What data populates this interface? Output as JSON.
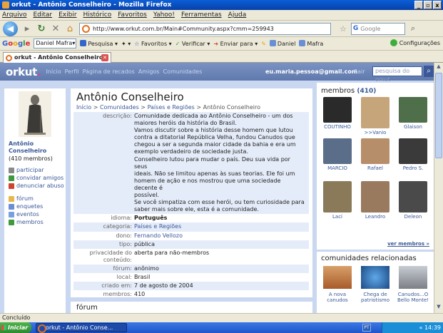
{
  "window": {
    "title": "orkut - Antônio Conselheiro - Mozilla Firefox",
    "controls": [
      "_",
      "▫",
      "x"
    ]
  },
  "menu": [
    "Arquivo",
    "Editar",
    "Exibir",
    "Histórico",
    "Favoritos",
    "Yahoo!",
    "Ferramentas",
    "Ajuda"
  ],
  "nav": {
    "url": "http://www.orkut.com.br/Main#Community.aspx?cmm=259943",
    "search_placeholder": "Google"
  },
  "gtoolbar": {
    "logo": [
      "G",
      "o",
      "o",
      "g",
      "l",
      "e"
    ],
    "user": "Daniel Mafra",
    "items": [
      "Pesquisa",
      "Favoritos",
      "Verificar",
      "Enviar para",
      "Daniel",
      "Mafra"
    ],
    "config": "Configurações"
  },
  "tab": {
    "label": "orkut - Antônio Conselheiro"
  },
  "orkut": {
    "logo": "orkut",
    "nav": [
      "Início",
      "Perfil",
      "Página de recados",
      "Amigos",
      "Comunidades"
    ],
    "email": "eu.maria.pessoa@gmail.com",
    "logout": "Sair",
    "search_placeholder": "pesquisa do orkut"
  },
  "community": {
    "name": "Antônio Conselheiro",
    "members_label": "(410 membros)",
    "breadcrumb": [
      "Início",
      "Comunidades",
      "Países e Regiões",
      "Antônio Conselheiro"
    ],
    "actions": [
      {
        "label": "participar",
        "icon": "join-icon",
        "color": "#8a8a8a"
      },
      {
        "label": "convidar amigos",
        "icon": "invite-icon",
        "color": "#3d9b3d"
      },
      {
        "label": "denunciar abuso",
        "icon": "report-icon",
        "color": "#d0442e"
      }
    ],
    "sections": [
      {
        "label": "fórum",
        "icon": "forum-icon",
        "color": "#e8b84a"
      },
      {
        "label": "enquetes",
        "icon": "polls-icon",
        "color": "#6a8fd4"
      },
      {
        "label": "eventos",
        "icon": "events-icon",
        "color": "#7a9fe0"
      },
      {
        "label": "membros",
        "icon": "members-icon",
        "color": "#3d9b3d"
      }
    ],
    "info": [
      {
        "key": "descrição:",
        "lines": [
          "Comunidade dedicada ao Antônio Conselheiro - um dos",
          "maiores heróis da história do Brasil.",
          "Vamos discutir sobre a história desse homem que lutou",
          "contra a ditatorial República Velha, fundou Canudos que",
          "chegou a ser a segunda maior cidade da bahia e era um",
          "exemplo verdadeiro de sociedade justa.",
          "Conselheiro lutou para mudar o país. Deu sua vida por seus",
          "ideais. Não se limitou apenas às suas teorias. Ele foi um",
          "homem de ação e nos mostrou que uma sociedade decente é",
          "possível.",
          "Se você simpatiza com esse herói, ou tem curiosidade para",
          "saber mais sobre ele, esta é a comunidade."
        ]
      },
      {
        "key": "idioma:",
        "value": "Português",
        "style": "b"
      },
      {
        "key": "categoria:",
        "value": "Países e Regiões",
        "style": "lk"
      },
      {
        "key": "dono:",
        "value": "Fernando Vellozo",
        "style": "lk"
      },
      {
        "key": "tipo:",
        "value": "pública"
      },
      {
        "key": "privacidade do conteúdo:",
        "value": "aberta para não-membros"
      },
      {
        "key": "fórum:",
        "value": "anônimo"
      },
      {
        "key": "local:",
        "value": "Brasil"
      },
      {
        "key": "criado em:",
        "value": "7 de agosto de 2004"
      },
      {
        "key": "membros:",
        "value": "410"
      }
    ],
    "forum_title": "fórum"
  },
  "members_panel": {
    "title": "membros",
    "count": "(410)",
    "members": [
      {
        "name": "COUTINHO",
        "color": "#2a2a2a"
      },
      {
        "name": ">>Vanio",
        "color": "#c7a57a"
      },
      {
        "name": "Glaison",
        "color": "#4f6e4a"
      },
      {
        "name": "MARCIO",
        "color": "#5a6e8a"
      },
      {
        "name": "Rafael",
        "color": "#b78e6a"
      },
      {
        "name": "Pedro S.",
        "color": "#3a3a3a"
      },
      {
        "name": "Laci",
        "color": "#8b7a5a"
      },
      {
        "name": "Leandro",
        "color": "#9a7a5e"
      },
      {
        "name": "Deleon",
        "color": "#4a4a4a"
      }
    ],
    "see_all": "ver membros »"
  },
  "related": {
    "title": "comunidades relacionadas",
    "items": [
      {
        "name": "A nova canudos",
        "color": "#c0703a"
      },
      {
        "name": "Chega de patriotismo",
        "color": "#2f6fb0"
      },
      {
        "name": "Canudos...O Bello Monte!",
        "color": "#9aa0a6"
      }
    ]
  },
  "status": "Concluído",
  "taskbar": {
    "start": "Iniciar",
    "item": "orkut - Antônio Conse...",
    "lang": "PT",
    "time": "« 14:39"
  }
}
